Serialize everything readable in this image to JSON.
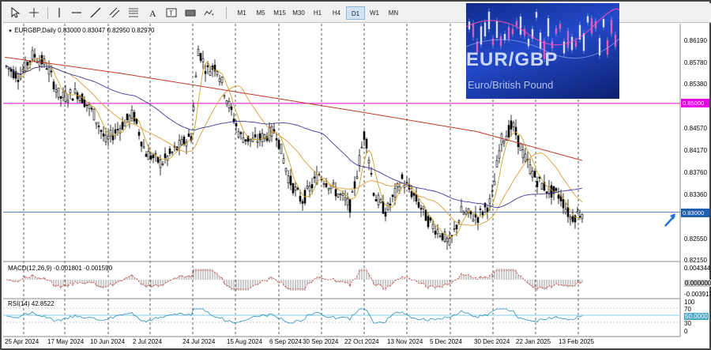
{
  "toolbar": {
    "timeframes": [
      "M1",
      "M5",
      "M15",
      "M30",
      "H1",
      "H4",
      "D1",
      "W1",
      "MN"
    ],
    "selected": "D1",
    "tools": [
      "cursor-icon",
      "crosshair-icon",
      "vertical-line-icon",
      "horizontal-line-icon",
      "trendline-icon",
      "equidistant-channel-icon",
      "fibonacci-icon",
      "text-icon",
      "text-label-icon",
      "rectangle-icon",
      "arrows-icon"
    ]
  },
  "chart": {
    "header": "EURGBP,Daily  0.83000 0.83047 0.82950 0.82970",
    "y_labels": [
      "0.86190",
      "0.85780",
      "0.85380",
      "0.85000",
      "0.84570",
      "0.84170",
      "0.83760",
      "0.83360",
      "0.83000",
      "0.82550",
      "0.82150"
    ],
    "current_price": "0.83000",
    "resistance_price": "0.85000",
    "x_labels": [
      "25 Apr 2024",
      "17 May 2024",
      "10 Jun 2024",
      "2 Jul 2024",
      "24 Jul 2024",
      "15 Aug 2024",
      "6 Sep 2024",
      "30 Sep 2024",
      "22 Oct 2024",
      "13 Nov 2024",
      "5 Dec 2024",
      "30 Dec 2024",
      "22 Jan 2025",
      "13 Feb 2025"
    ],
    "colors": {
      "ma_fast": "#c9a227",
      "ma_mid": "#e09b3a",
      "ma_blue": "#3a3aa0",
      "ma_red": "#c0392b",
      "resistance": "#e600e6",
      "current": "#1e5fb0"
    }
  },
  "macd": {
    "label": "MACD(12,26,9) -0.001801 -0.001590",
    "y_labels": [
      "0.004344",
      "0.000000",
      "-0.003917"
    ]
  },
  "rsi": {
    "label": "RSI(14) 42.8522",
    "y_labels": [
      "100",
      "70",
      "50.0000",
      "30",
      "0"
    ]
  },
  "banner": {
    "title": "EUR/GBP",
    "subtitle": "Euro/British Pound"
  }
}
